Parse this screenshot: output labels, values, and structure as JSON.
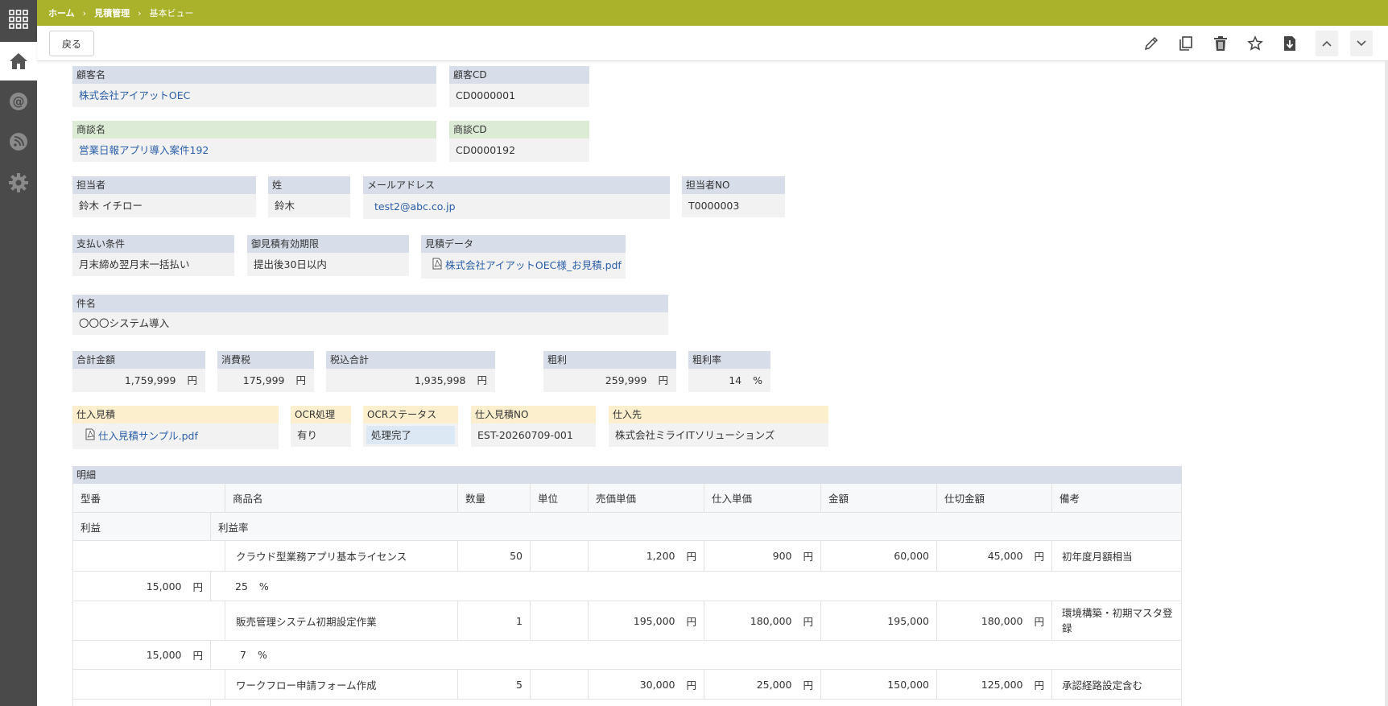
{
  "breadcrumb": {
    "home": "ホーム",
    "module": "見積管理",
    "view": "基本ビュー"
  },
  "toolbar": {
    "back_label": "戻る"
  },
  "customer": {
    "name_label": "顧客名",
    "name_value": "株式会社アイアットOEC",
    "cd_label": "顧客CD",
    "cd_value": "CD0000001"
  },
  "deal": {
    "name_label": "商談名",
    "name_value": "営業日報アプリ導入案件192",
    "cd_label": "商談CD",
    "cd_value": "CD0000192"
  },
  "staff": {
    "person_label": "担当者",
    "person_value": "鈴木 イチロー",
    "surname_label": "姓",
    "surname_value": "鈴木",
    "email_label": "メールアドレス",
    "email_value": "test2@abc.co.jp",
    "no_label": "担当者NO",
    "no_value": "T0000003"
  },
  "terms": {
    "payment_label": "支払い条件",
    "payment_value": "月末締め翌月末一括払い",
    "validity_label": "御見積有効期限",
    "validity_value": "提出後30日以内",
    "data_label": "見積データ",
    "data_value": "株式会社アイアットOEC様_お見積.pdf"
  },
  "subject": {
    "label": "件名",
    "value": "〇〇〇システム導入"
  },
  "totals": {
    "amount_label": "合計金額",
    "amount_value": "1,759,999",
    "tax_label": "消費税",
    "tax_value": "175,999",
    "total_label": "税込合計",
    "total_value": "1,935,998",
    "profit_label": "粗利",
    "profit_value": "259,999",
    "rate_label": "粗利率",
    "rate_value": "14",
    "yen": "円",
    "percent": "%"
  },
  "purchase": {
    "quote_label": "仕入見積",
    "quote_value": "仕入見積サンプル.pdf",
    "ocr_label": "OCR処理",
    "ocr_value": "有り",
    "ocr_status_label": "OCRステータス",
    "ocr_status_value": "処理完了",
    "no_label": "仕入見積NO",
    "no_value": "EST-20260709-001",
    "supplier_label": "仕入先",
    "supplier_value": "株式会社ミライITソリューションズ"
  },
  "detail": {
    "label": "明細",
    "headers": [
      "型番",
      "商品名",
      "数量",
      "単位",
      "売価単価",
      "仕入単価",
      "金額",
      "仕切金額",
      "備考"
    ],
    "sub_headers": [
      "利益",
      "利益率"
    ],
    "rows": [
      {
        "model": "",
        "name": "クラウド型業務アプリ基本ライセンス",
        "qty": "50",
        "unit": "",
        "price": "1,200",
        "cost": "900",
        "amount": "60,000",
        "cost_amount": "45,000",
        "note": "初年度月額相当",
        "profit": "15,000",
        "rate": "25"
      },
      {
        "model": "",
        "name": "販売管理システム初期設定作業",
        "qty": "1",
        "unit": "",
        "price": "195,000",
        "cost": "180,000",
        "amount": "195,000",
        "cost_amount": "180,000",
        "note": "環境構築・初期マスタ登録",
        "profit": "15,000",
        "rate": "7"
      },
      {
        "model": "",
        "name": "ワークフロー申請フォーム作成",
        "qty": "5",
        "unit": "",
        "price": "30,000",
        "cost": "25,000",
        "amount": "150,000",
        "cost_amount": "125,000",
        "note": "承認経路設定含む"
      }
    ]
  },
  "colors": {
    "header_bar": "#a9b22a",
    "rail": "#4a4a4a",
    "label_blue": "#d8dee9",
    "label_green": "#dcebd5",
    "label_yellow": "#fcefcd",
    "link": "#2a5ea8"
  }
}
